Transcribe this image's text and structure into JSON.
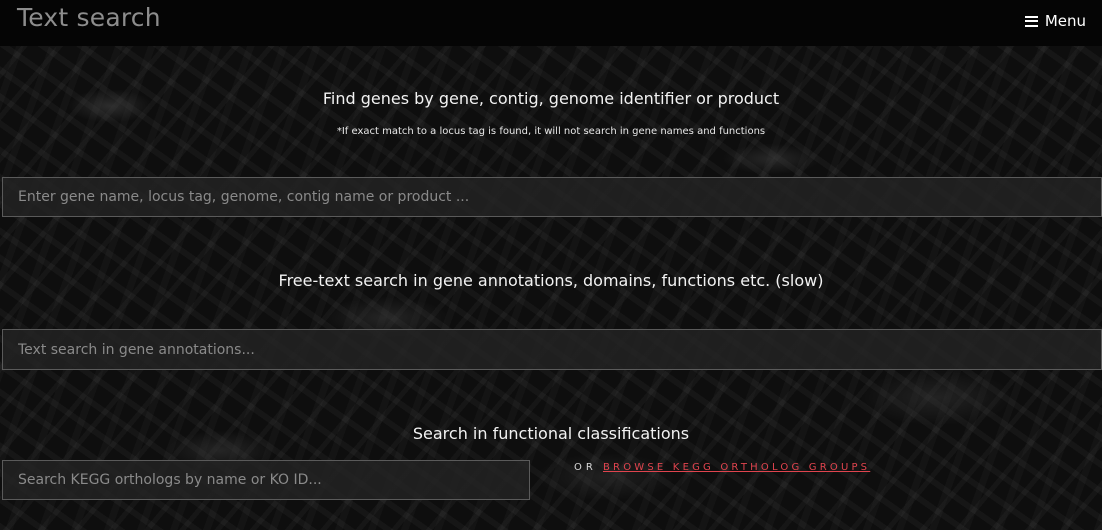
{
  "header": {
    "title": "Text search",
    "menu_label": "Menu",
    "menu_icon": "hamburger-icon"
  },
  "gene_search": {
    "heading": "Find genes by gene, contig, genome identifier or product",
    "note": "*If exact match to a locus tag is found, it will not search in gene names and functions",
    "placeholder": "Enter gene name, locus tag, genome, contig name or product ...",
    "value": ""
  },
  "freetext_search": {
    "heading": "Free-text search in gene annotations, domains, functions etc. (slow)",
    "placeholder": "Text search in gene annotations...",
    "value": ""
  },
  "functional_search": {
    "heading": "Search in functional classifications",
    "placeholder": "Search KEGG orthologs by name or KO ID...",
    "value": "",
    "or_label": "OR",
    "browse_link": "BROWSE KEGG ORTHOLOG GROUPS"
  },
  "colors": {
    "link": "#e0444e",
    "topbar": "#050505",
    "title": "#8d8d8d"
  }
}
